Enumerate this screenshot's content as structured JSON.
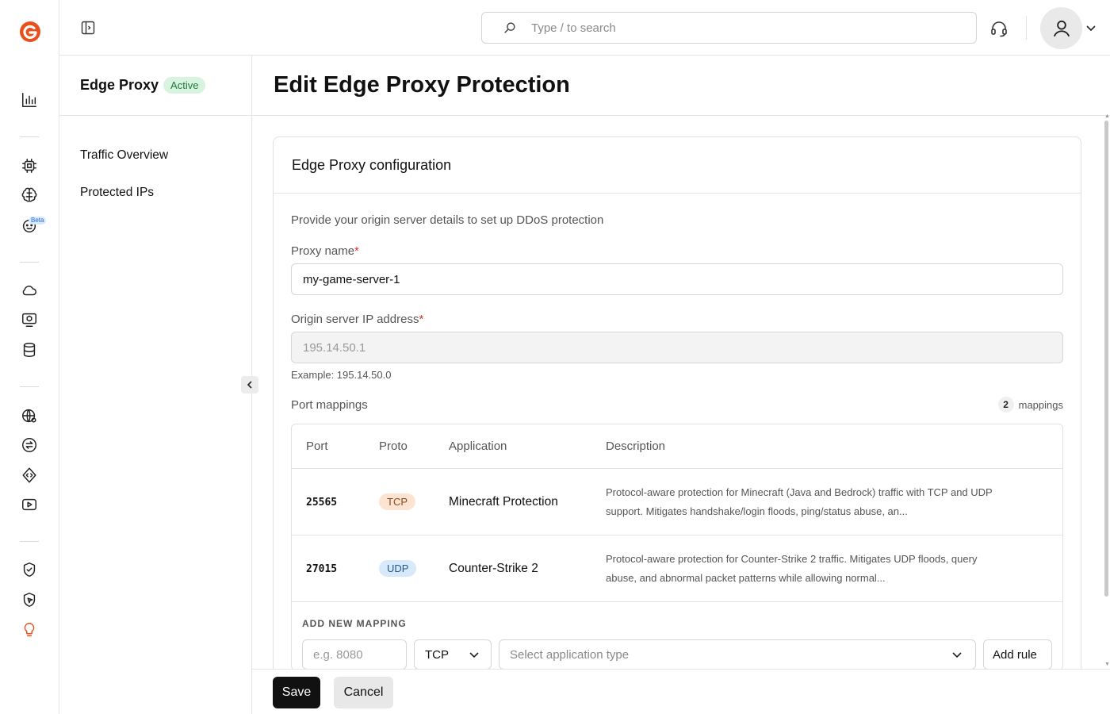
{
  "search": {
    "placeholder": "Type / to search"
  },
  "rail": {
    "beta_label": "Beta"
  },
  "sidebar": {
    "title": "Edge Proxy",
    "status": "Active",
    "items": [
      {
        "label": "Traffic Overview"
      },
      {
        "label": "Protected IPs"
      }
    ]
  },
  "page": {
    "title": "Edit Edge Proxy Protection"
  },
  "card": {
    "title": "Edge Proxy configuration",
    "intro": "Provide your origin server details to set up DDoS protection",
    "proxy_name": {
      "label": "Proxy name",
      "required": "*",
      "value": "my-game-server-1"
    },
    "origin_ip": {
      "label": "Origin server IP address",
      "required": "*",
      "value": "195.14.50.1",
      "hint": "Example: 195.14.50.0"
    },
    "port_mappings": {
      "label": "Port mappings",
      "count": "2",
      "count_label": "mappings",
      "columns": [
        "Port",
        "Proto",
        "Application",
        "Description"
      ],
      "rows": [
        {
          "port": "25565",
          "proto": "TCP",
          "application": "Minecraft Protection",
          "description": "Protocol-aware protection for Minecraft (Java and Bedrock) traffic with TCP and UDP support. Mitigates handshake/login floods, ping/status abuse, an..."
        },
        {
          "port": "27015",
          "proto": "UDP",
          "application": "Counter-Strike 2",
          "description": "Protocol-aware protection for Counter-Strike 2 traffic. Mitigates UDP floods, query abuse, and abnormal packet patterns while allowing normal..."
        }
      ],
      "add_new": {
        "caption": "ADD NEW MAPPING",
        "port_placeholder": "e.g. 8080",
        "proto_value": "TCP",
        "app_placeholder": "Select application type",
        "add_button": "Add rule"
      }
    }
  },
  "footer": {
    "save": "Save",
    "cancel": "Cancel"
  },
  "colors": {
    "brand": "#e8501c",
    "active_badge_bg": "#d8f3df",
    "tcp_bg": "#fde3d2",
    "udp_bg": "#d8e9fb"
  }
}
